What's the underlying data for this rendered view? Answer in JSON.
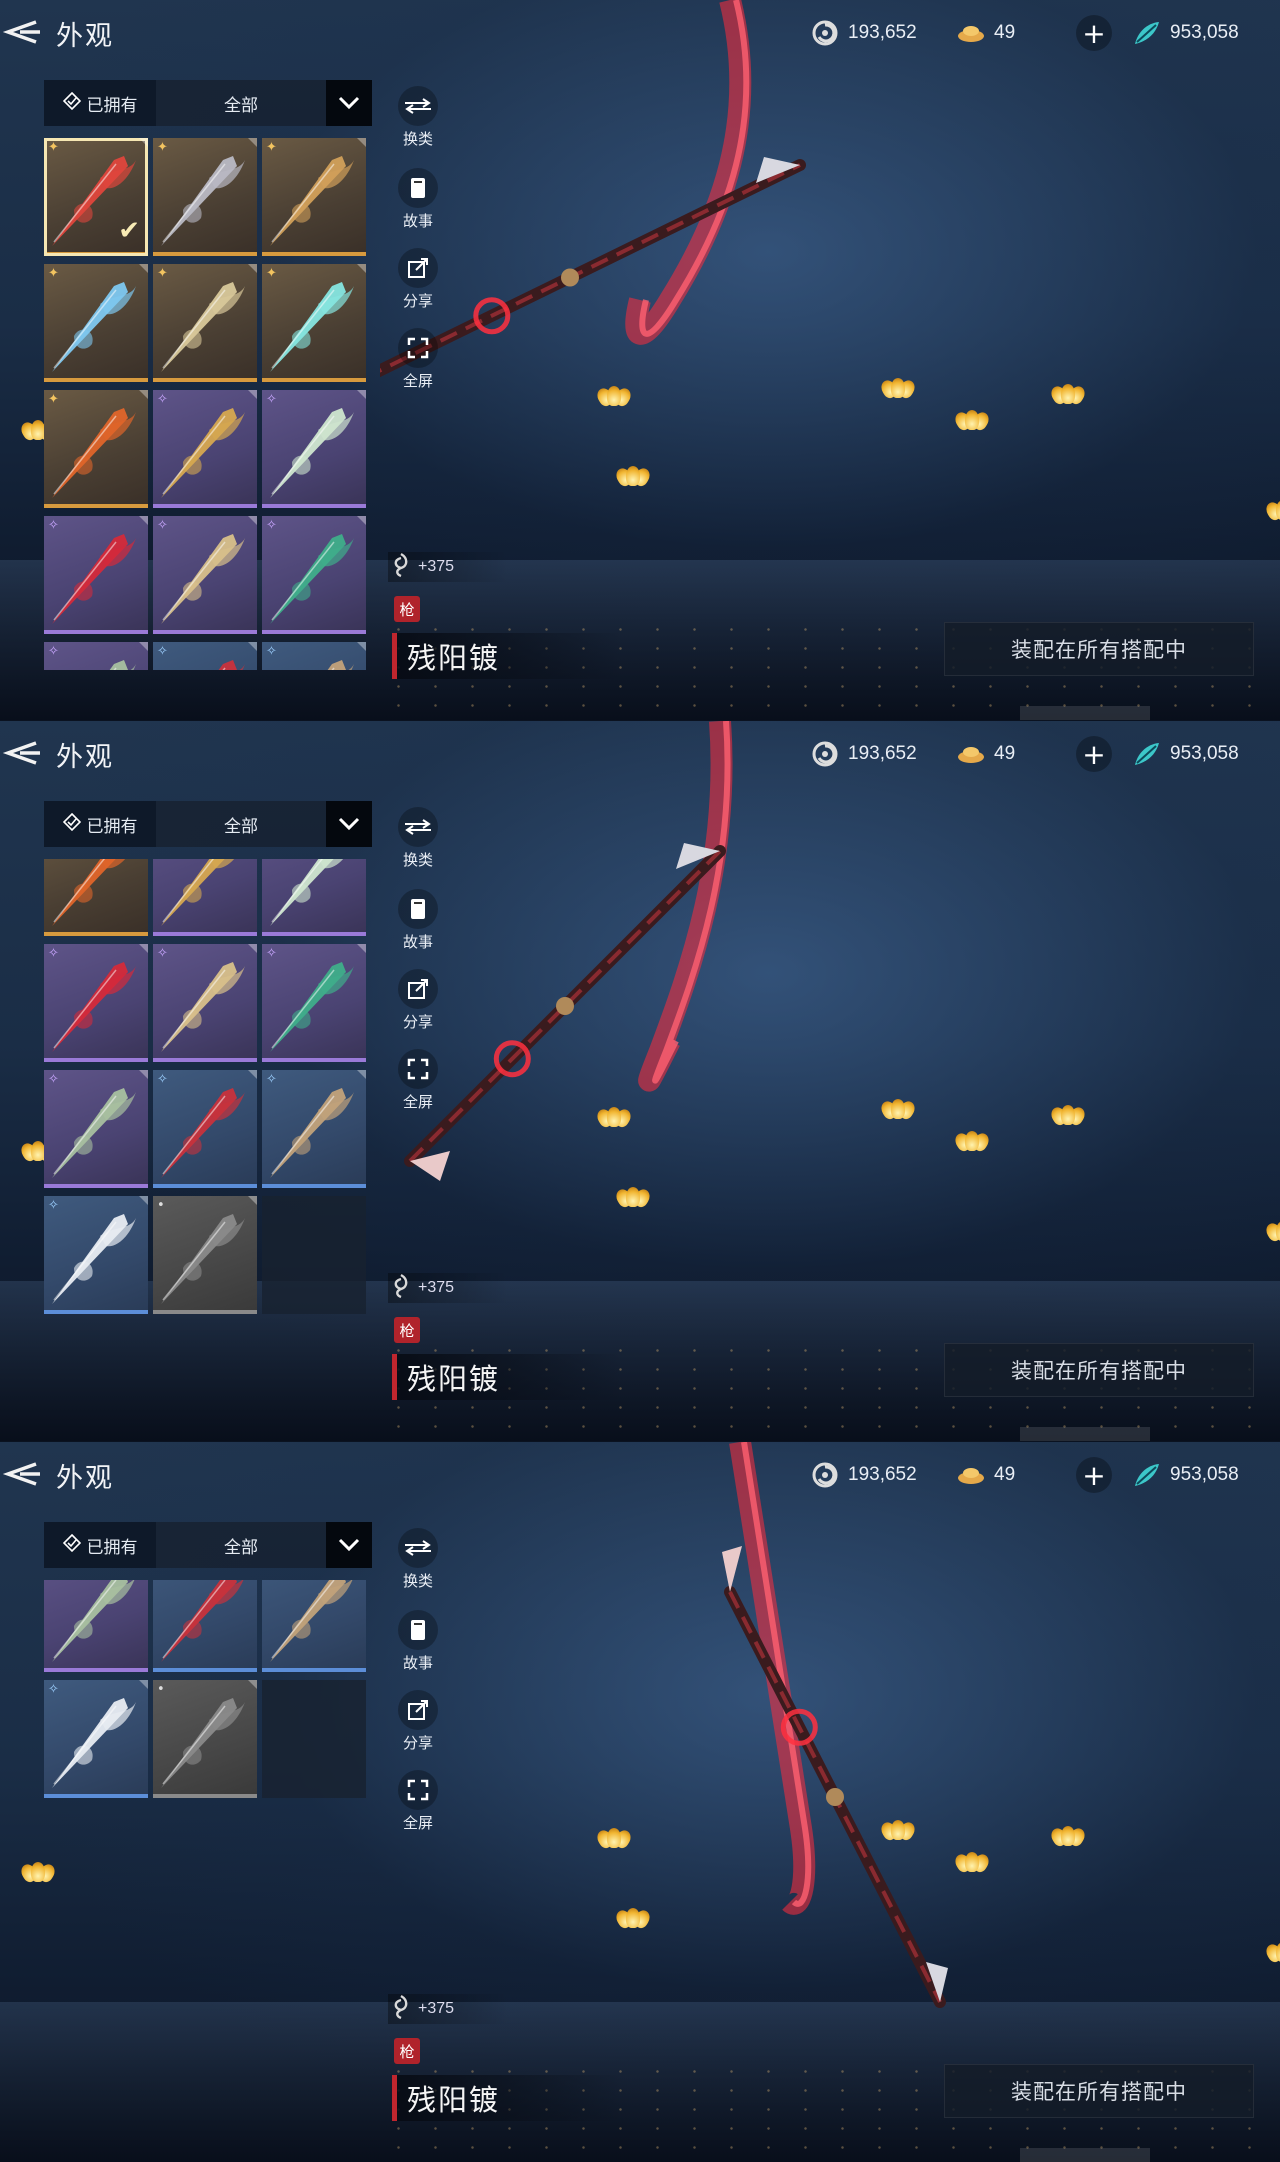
{
  "screens": [
    {
      "header": {
        "title": "外观"
      },
      "currencies": [
        {
          "icon": "spiral-coin-icon",
          "value": "193,652"
        },
        {
          "icon": "gold-ingot-icon",
          "value": "49"
        },
        {
          "icon": "jade-leaf-icon",
          "value": "953,058"
        }
      ],
      "filter": {
        "owned": "已拥有",
        "category": "全部"
      },
      "tools": [
        {
          "icon": "swap-weapon-icon",
          "label": "换类"
        },
        {
          "icon": "book-icon",
          "label": "故事"
        },
        {
          "icon": "share-icon",
          "label": "分享"
        },
        {
          "icon": "fullscreen-icon",
          "label": "全屏"
        }
      ],
      "weapon": {
        "power": "+375",
        "type": "枪",
        "name": "残阳镀"
      },
      "equip_button": "装配在所有搭配中"
    },
    {
      "header": {
        "title": "外观"
      },
      "currencies": [
        {
          "icon": "spiral-coin-icon",
          "value": "193,652"
        },
        {
          "icon": "gold-ingot-icon",
          "value": "49"
        },
        {
          "icon": "jade-leaf-icon",
          "value": "953,058"
        }
      ],
      "filter": {
        "owned": "已拥有",
        "category": "全部"
      },
      "tools": [
        {
          "icon": "swap-weapon-icon",
          "label": "换类"
        },
        {
          "icon": "book-icon",
          "label": "故事"
        },
        {
          "icon": "share-icon",
          "label": "分享"
        },
        {
          "icon": "fullscreen-icon",
          "label": "全屏"
        }
      ],
      "weapon": {
        "power": "+375",
        "type": "枪",
        "name": "残阳镀"
      },
      "equip_button": "装配在所有搭配中"
    },
    {
      "header": {
        "title": "外观"
      },
      "currencies": [
        {
          "icon": "spiral-coin-icon",
          "value": "193,652"
        },
        {
          "icon": "gold-ingot-icon",
          "value": "49"
        },
        {
          "icon": "jade-leaf-icon",
          "value": "953,058"
        }
      ],
      "filter": {
        "owned": "已拥有",
        "category": "全部"
      },
      "tools": [
        {
          "icon": "swap-weapon-icon",
          "label": "换类"
        },
        {
          "icon": "book-icon",
          "label": "故事"
        },
        {
          "icon": "share-icon",
          "label": "分享"
        },
        {
          "icon": "fullscreen-icon",
          "label": "全屏"
        }
      ],
      "weapon": {
        "power": "+375",
        "type": "枪",
        "name": "残阳镀"
      },
      "equip_button": "装配在所有搭配中"
    }
  ],
  "skin_items": [
    {
      "rarity": "gold",
      "color": "#e0463c",
      "selected": true
    },
    {
      "rarity": "gold",
      "color": "#b9b9c4"
    },
    {
      "rarity": "gold",
      "color": "#d2a05a"
    },
    {
      "rarity": "gold",
      "color": "#7ec8f0"
    },
    {
      "rarity": "gold",
      "color": "#d8c89a"
    },
    {
      "rarity": "gold",
      "color": "#86e6e0"
    },
    {
      "rarity": "gold",
      "color": "#e0652a"
    },
    {
      "rarity": "purple",
      "color": "#d6a850"
    },
    {
      "rarity": "purple",
      "color": "#cfe6cf"
    },
    {
      "rarity": "purple",
      "color": "#d42a3a"
    },
    {
      "rarity": "purple",
      "color": "#d8c08a"
    },
    {
      "rarity": "purple",
      "color": "#3fae8a"
    },
    {
      "rarity": "purple",
      "color": "#a8c0a0"
    },
    {
      "rarity": "blue",
      "color": "#c8323c"
    },
    {
      "rarity": "blue",
      "color": "#c2a27a"
    },
    {
      "rarity": "blue",
      "color": "#e8ecf2"
    },
    {
      "rarity": "grey",
      "color": "#8a8a8a"
    },
    {
      "rarity": "empty"
    }
  ]
}
